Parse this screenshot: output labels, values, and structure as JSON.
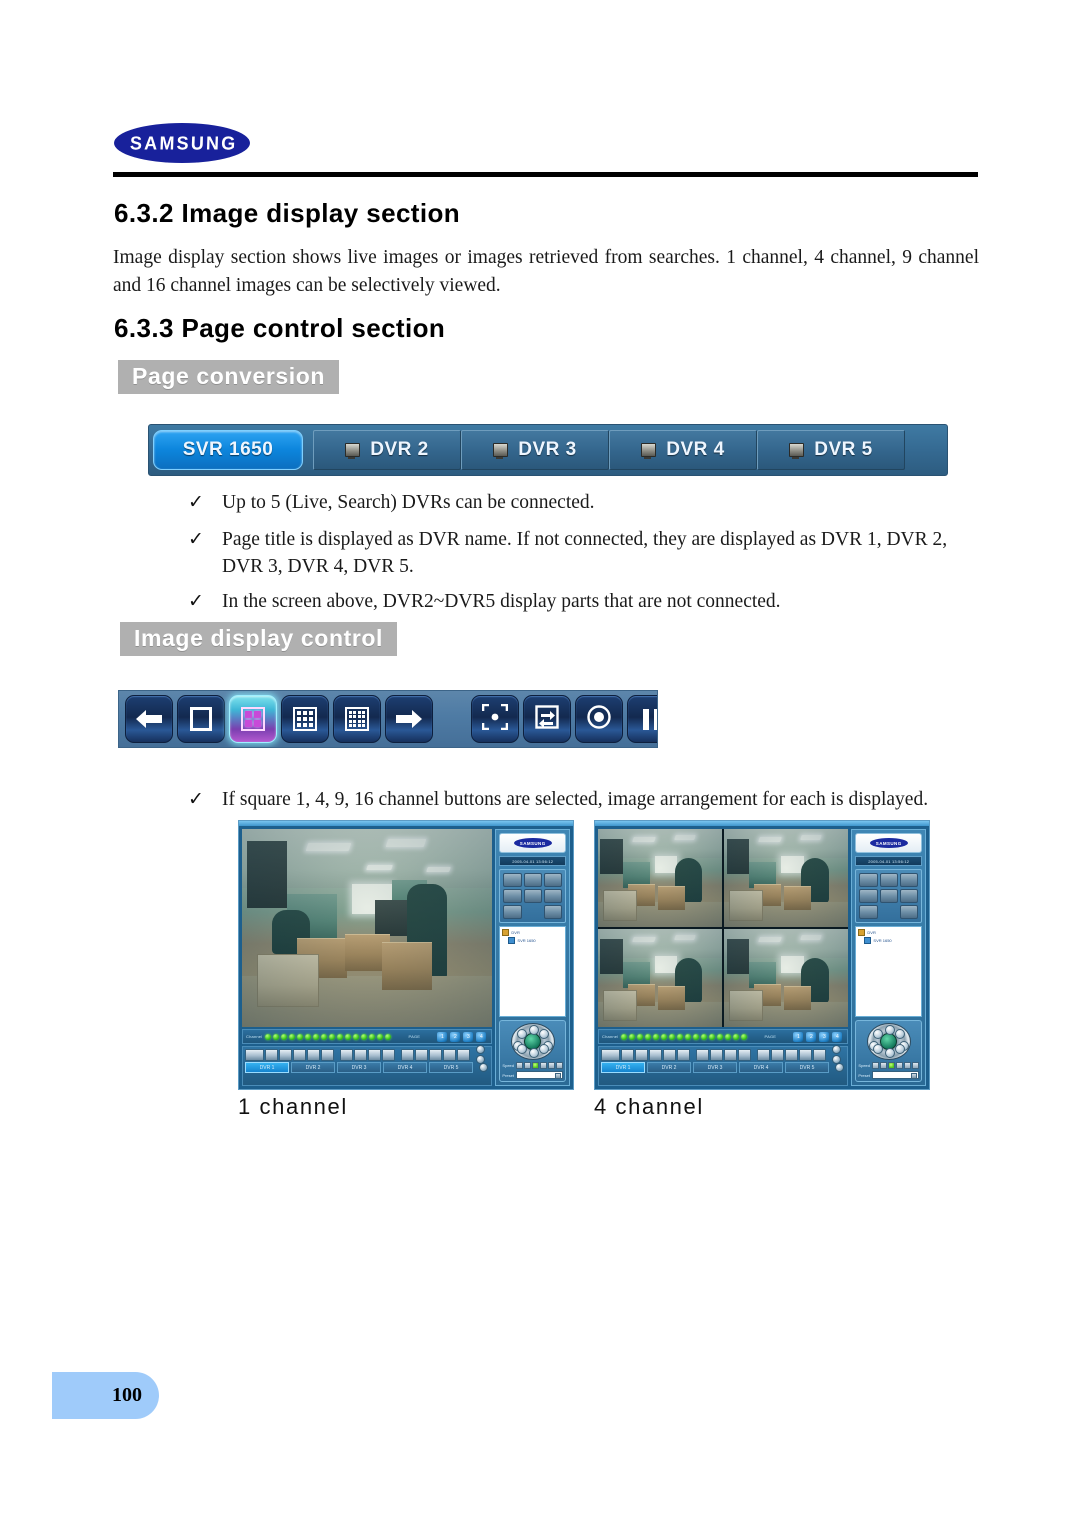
{
  "header": {
    "logo_text": "SAMSUNG",
    "logo_color": "#18219b"
  },
  "sections": {
    "s632_heading": "6.3.2 Image display section",
    "s632_body": "Image display section shows live images or images retrieved from searches. 1 channel, 4 channel, 9 channel and 16 channel images can be selectively viewed.",
    "s633_heading": "6.3.3 Page control section"
  },
  "banners": {
    "page_conversion": "Page conversion",
    "image_display_control": "Image display control"
  },
  "tab_strip": {
    "active_tab": "SVR 1650",
    "tabs": [
      {
        "label": "SVR 1650",
        "active": true,
        "icon": "none"
      },
      {
        "label": "DVR 2",
        "active": false,
        "icon": "monitor-icon"
      },
      {
        "label": "DVR 3",
        "active": false,
        "icon": "monitor-icon"
      },
      {
        "label": "DVR 4",
        "active": false,
        "icon": "monitor-icon"
      },
      {
        "label": "DVR 5",
        "active": false,
        "icon": "monitor-icon"
      }
    ],
    "active_color": "#0d86dd",
    "strip_color": "#356a92"
  },
  "bullets": {
    "check_glyph": "✓",
    "b1": "Up to 5 (Live, Search) DVRs can be connected.",
    "b2": "Page title is displayed as DVR name. If not connected, they are displayed as DVR 1, DVR 2, DVR 3, DVR 4, DVR 5.",
    "b3": "In the screen above, DVR2~DVR5 display parts that are not connected.",
    "b4": "If square 1, 4, 9, 16 channel buttons are selected, image arrangement for each is displayed."
  },
  "toolbar": {
    "background": "#4e7ba4",
    "buttons": [
      {
        "name": "previous-page-button",
        "icon": "arrow-left-icon",
        "active": false
      },
      {
        "name": "one-channel-button",
        "icon": "single-square-icon",
        "active": false
      },
      {
        "name": "four-channel-button",
        "icon": "grid-2x2-icon",
        "active": true
      },
      {
        "name": "nine-channel-button",
        "icon": "grid-3x3-icon",
        "active": false
      },
      {
        "name": "sixteen-channel-button",
        "icon": "grid-4x4-icon",
        "active": false
      },
      {
        "name": "next-page-button",
        "icon": "arrow-right-icon",
        "active": false
      },
      {
        "name": "fullscreen-button",
        "icon": "fullscreen-icon",
        "active": false
      },
      {
        "name": "sequence-button",
        "icon": "sequence-refresh-icon",
        "active": false
      },
      {
        "name": "record-button",
        "icon": "record-circle-icon",
        "active": false
      },
      {
        "name": "pause-button",
        "icon": "pause-icon",
        "active": false
      }
    ]
  },
  "screenshots": [
    {
      "name": "dvr-client-1-channel",
      "caption": "1 channel",
      "layout": "one",
      "scene": "office cubicles with desks, chairs and cardboard boxes",
      "panel": {
        "logo": "SAMSUNG",
        "date_bar": "2005-04-01 13:56:12",
        "tree_root": "DVR",
        "tree_child": "SVR 1650",
        "ptz_speed_label": "Speed",
        "ptz_preset_label": "Preset"
      },
      "status": {
        "channel_label": "Channel",
        "channel_led_count": 16,
        "page_label": "PAGE",
        "pages": [
          "1",
          "2",
          "3",
          "4"
        ]
      },
      "bottom_tabs": [
        "DVR 1",
        "DVR 2",
        "DVR 3",
        "DVR 4",
        "DVR 5"
      ],
      "selected_bottom_tab": "DVR 1"
    },
    {
      "name": "dvr-client-4-channel",
      "caption": "4 channel",
      "layout": "four",
      "scene": "office cubicles with desks, chairs and cardboard boxes",
      "panel": {
        "logo": "SAMSUNG",
        "date_bar": "2005-04-01 13:56:12",
        "tree_root": "DVR",
        "tree_child": "SVR 1650",
        "ptz_speed_label": "Speed",
        "ptz_preset_label": "Preset"
      },
      "status": {
        "channel_label": "Channel",
        "channel_led_count": 16,
        "page_label": "PAGE",
        "pages": [
          "1",
          "2",
          "3",
          "4"
        ]
      },
      "bottom_tabs": [
        "DVR 1",
        "DVR 2",
        "DVR 3",
        "DVR 4",
        "DVR 5"
      ],
      "selected_bottom_tab": "DVR 1"
    }
  ],
  "footer": {
    "page_number": "100",
    "tab_color": "#9fcbfa"
  }
}
